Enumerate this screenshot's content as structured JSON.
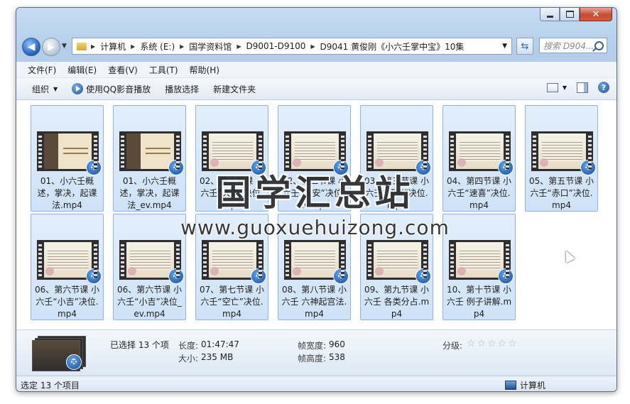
{
  "window": {
    "buttons": {
      "minimize": "minimize",
      "maximize": "maximize",
      "close": "close"
    }
  },
  "address": {
    "segments": [
      "计算机",
      "系统 (E:)",
      "国学资料馆",
      "D9001-D9100",
      "D9041 黄俊刚《小六壬掌中宝》10集"
    ],
    "search_placeholder": "搜索 D904..."
  },
  "menu": [
    "文件(F)",
    "编辑(E)",
    "查看(V)",
    "工具(T)",
    "帮助(H)"
  ],
  "toolbar": {
    "organize": "组织",
    "play_qq": "使用QQ影音播放",
    "play_selected": "播放选择",
    "new_folder": "新建文件夹"
  },
  "files": [
    {
      "name": "01、小六壬概述，掌决，起课法.mp4",
      "thumb": "portrait"
    },
    {
      "name": "01、小六壬概述，掌决，起课法_ev.mp4",
      "thumb": "portrait"
    },
    {
      "name": "02、第二节课 小六壬“大安”决位.mp4",
      "thumb": "text"
    },
    {
      "name": "02、第二节课 小六壬“大安”决位_ev.mp4",
      "thumb": "text"
    },
    {
      "name": "03、第三节课 小六壬“留连”决位.mp4",
      "thumb": "text"
    },
    {
      "name": "04、第四节课 小六壬“速喜”决位.mp4",
      "thumb": "text"
    },
    {
      "name": "05、第五节课 小六壬“赤口”决位.mp4",
      "thumb": "text"
    },
    {
      "name": "06、第六节课 小六壬“小吉”决位.mp4",
      "thumb": "text"
    },
    {
      "name": "06、第六节课 小六壬“小吉”决位_ev.mp4",
      "thumb": "text"
    },
    {
      "name": "07、第七节课 小六壬“空亡”决位.mp4",
      "thumb": "text"
    },
    {
      "name": "08、第八节课 小六壬 六神起宫法.mp4",
      "thumb": "text"
    },
    {
      "name": "09、第九节课 小六壬 各类分占.mp4",
      "thumb": "text"
    },
    {
      "name": "10、第十节课 小六壬 例子讲解.mp4",
      "thumb": "text"
    }
  ],
  "watermark": {
    "title": "国学汇总站",
    "url": "www.guoxuehuizong.com"
  },
  "details": {
    "selected": "已选择 13 个项",
    "length_label": "长度:",
    "length_value": "01:47:47",
    "size_label": "大小:",
    "size_value": "235 MB",
    "width_label": "帧宽度:",
    "width_value": "960",
    "height_label": "帧高度:",
    "height_value": "538",
    "rating_label": "分级:",
    "rating": 0
  },
  "status": {
    "left": "选定 13 个项目",
    "right": "计算机"
  }
}
